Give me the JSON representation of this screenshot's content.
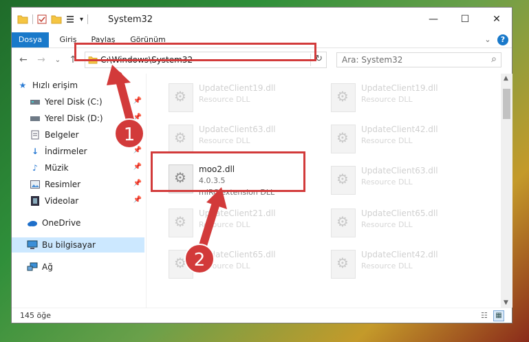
{
  "window": {
    "title": "System32",
    "min": "—",
    "max": "☐",
    "close": "✕"
  },
  "ribbon": {
    "tabs": [
      {
        "label": "Dosya"
      },
      {
        "label": "Giriş"
      },
      {
        "label": "Paylaş"
      },
      {
        "label": "Görünüm"
      }
    ],
    "expand": "⌄",
    "help": "?"
  },
  "nav": {
    "back": "←",
    "forward": "→",
    "recent": "⌄",
    "up": "↑",
    "address": "C:\\Windows\\System32",
    "address_dropdown": "⌄",
    "refresh": "↻",
    "search_placeholder": "Ara: System32",
    "search_icon": "⌕"
  },
  "sidebar": {
    "items": [
      {
        "label": "Hızlı erişim",
        "icon": "star-icon"
      },
      {
        "label": "Yerel Disk (C:)",
        "icon": "drive-icon"
      },
      {
        "label": "Yerel Disk (D:)",
        "icon": "drive-icon"
      },
      {
        "label": "Belgeler",
        "icon": "document-icon"
      },
      {
        "label": "İndirmeler",
        "icon": "download-icon"
      },
      {
        "label": "Müzik",
        "icon": "music-icon"
      },
      {
        "label": "Resimler",
        "icon": "picture-icon"
      },
      {
        "label": "Videolar",
        "icon": "video-icon"
      },
      {
        "label": "OneDrive",
        "icon": "cloud-icon"
      },
      {
        "label": "Bu bilgisayar",
        "icon": "computer-icon"
      },
      {
        "label": "Ağ",
        "icon": "network-icon"
      }
    ]
  },
  "files": {
    "left": [
      {
        "name": "UpdateClient19.dll",
        "sub": "Resource DLL"
      },
      {
        "name": "UpdateClient63.dll",
        "sub": "Resource DLL"
      },
      {
        "name": "moo2.dll",
        "version": "4.0.3.5",
        "sub": "mIRC extension DLL"
      },
      {
        "name": "UpdateClient21.dll",
        "sub": "Resource DLL"
      },
      {
        "name": "UpdateClient65.dll",
        "sub": "Resource DLL"
      }
    ],
    "right": [
      {
        "name": "UpdateClient19.dll",
        "sub": "Resource DLL"
      },
      {
        "name": "UpdateClient42.dll",
        "sub": "Resource DLL"
      },
      {
        "name": "UpdateClient63.dll",
        "sub": "Resource DLL"
      },
      {
        "name": "UpdateClient65.dll",
        "sub": "Resource DLL"
      },
      {
        "name": "UpdateClient42.dll",
        "sub": "Resource DLL"
      }
    ]
  },
  "status": {
    "count": "145 öğe"
  },
  "callouts": {
    "one": "1",
    "two": "2"
  },
  "colors": {
    "accent": "#1979ca",
    "highlight": "#d23a3a",
    "selection": "#cce8ff"
  }
}
